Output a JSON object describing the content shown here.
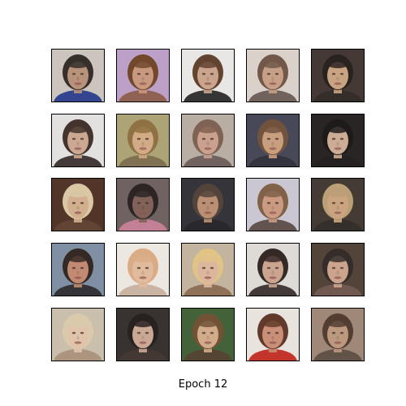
{
  "caption": "Epoch 12",
  "grid": {
    "rows": 5,
    "cols": 5,
    "samples": [
      {
        "bg": "#c9c2bb",
        "hair": "#2c2420",
        "skin": "#b58d74",
        "shirt": "#2a3a8a"
      },
      {
        "bg": "#b99bc4",
        "hair": "#6b3f22",
        "skin": "#c69478",
        "shirt": "#8a5a4a"
      },
      {
        "bg": "#e8e6e4",
        "hair": "#5a3a26",
        "skin": "#c9a088",
        "shirt": "#2b2b2b"
      },
      {
        "bg": "#d8cfc8",
        "hair": "#6a5040",
        "skin": "#c49a80",
        "shirt": "#6a5a55"
      },
      {
        "bg": "#3a2f2a",
        "hair": "#1e1814",
        "skin": "#c8a07c",
        "shirt": "#2a221e"
      },
      {
        "bg": "#e2e0de",
        "hair": "#3a2a22",
        "skin": "#c9a48c",
        "shirt": "#3a3030"
      },
      {
        "bg": "#a8a070",
        "hair": "#8a6a3a",
        "skin": "#d0a680",
        "shirt": "#7a6a4a"
      },
      {
        "bg": "#b6aaa0",
        "hair": "#7a5a4a",
        "skin": "#c89c88",
        "shirt": "#6a5a58"
      },
      {
        "bg": "#3e4050",
        "hair": "#6a4a34",
        "skin": "#c59a78",
        "shirt": "#2a2a34"
      },
      {
        "bg": "#1e1a1a",
        "hair": "#120e0e",
        "skin": "#caa890",
        "shirt": "#1a1616"
      },
      {
        "bg": "#4a2a1e",
        "hair": "#d8c6a0",
        "skin": "#d0ab88",
        "shirt": "#5a3a2a"
      },
      {
        "bg": "#6a5a5a",
        "hair": "#221a1a",
        "skin": "#7a5a50",
        "shirt": "#c07a90"
      },
      {
        "bg": "#2a2a30",
        "hair": "#4a3a30",
        "skin": "#b88a6c",
        "shirt": "#1e1e22"
      },
      {
        "bg": "#c8c4d0",
        "hair": "#7a5a40",
        "skin": "#c8967a",
        "shirt": "#5a4a48"
      },
      {
        "bg": "#3a322a",
        "hair": "#b89a70",
        "skin": "#c8a07a",
        "shirt": "#2a2420"
      },
      {
        "bg": "#7a8aa0",
        "hair": "#2a1e1a",
        "skin": "#c0846c",
        "shirt": "#2a2a2e"
      },
      {
        "bg": "#ece6e0",
        "hair": "#d8a880",
        "skin": "#e0b898",
        "shirt": "#c8b0a0"
      },
      {
        "bg": "#c0b09a",
        "hair": "#e0c080",
        "skin": "#dcb498",
        "shirt": "#8a6a50"
      },
      {
        "bg": "#ddd8d4",
        "hair": "#2a1e1a",
        "skin": "#c8a08a",
        "shirt": "#3a3030"
      },
      {
        "bg": "#4a3a30",
        "hair": "#2a2220",
        "skin": "#caa088",
        "shirt": "#6a5048"
      },
      {
        "bg": "#c8bca8",
        "hair": "#d8c8a8",
        "skin": "#e0c0a8",
        "shirt": "#a89078"
      },
      {
        "bg": "#2e2826",
        "hair": "#1c1614",
        "skin": "#c8a490",
        "shirt": "#3a2e2a"
      },
      {
        "bg": "#3a5a30",
        "hair": "#6a4a2a",
        "skin": "#d0a884",
        "shirt": "#4a3a2a"
      },
      {
        "bg": "#e8e2dc",
        "hair": "#5a3020",
        "skin": "#c88a70",
        "shirt": "#c02a20"
      },
      {
        "bg": "#9a8270",
        "hair": "#4a3428",
        "skin": "#b89478",
        "shirt": "#5a4a40"
      }
    ]
  }
}
